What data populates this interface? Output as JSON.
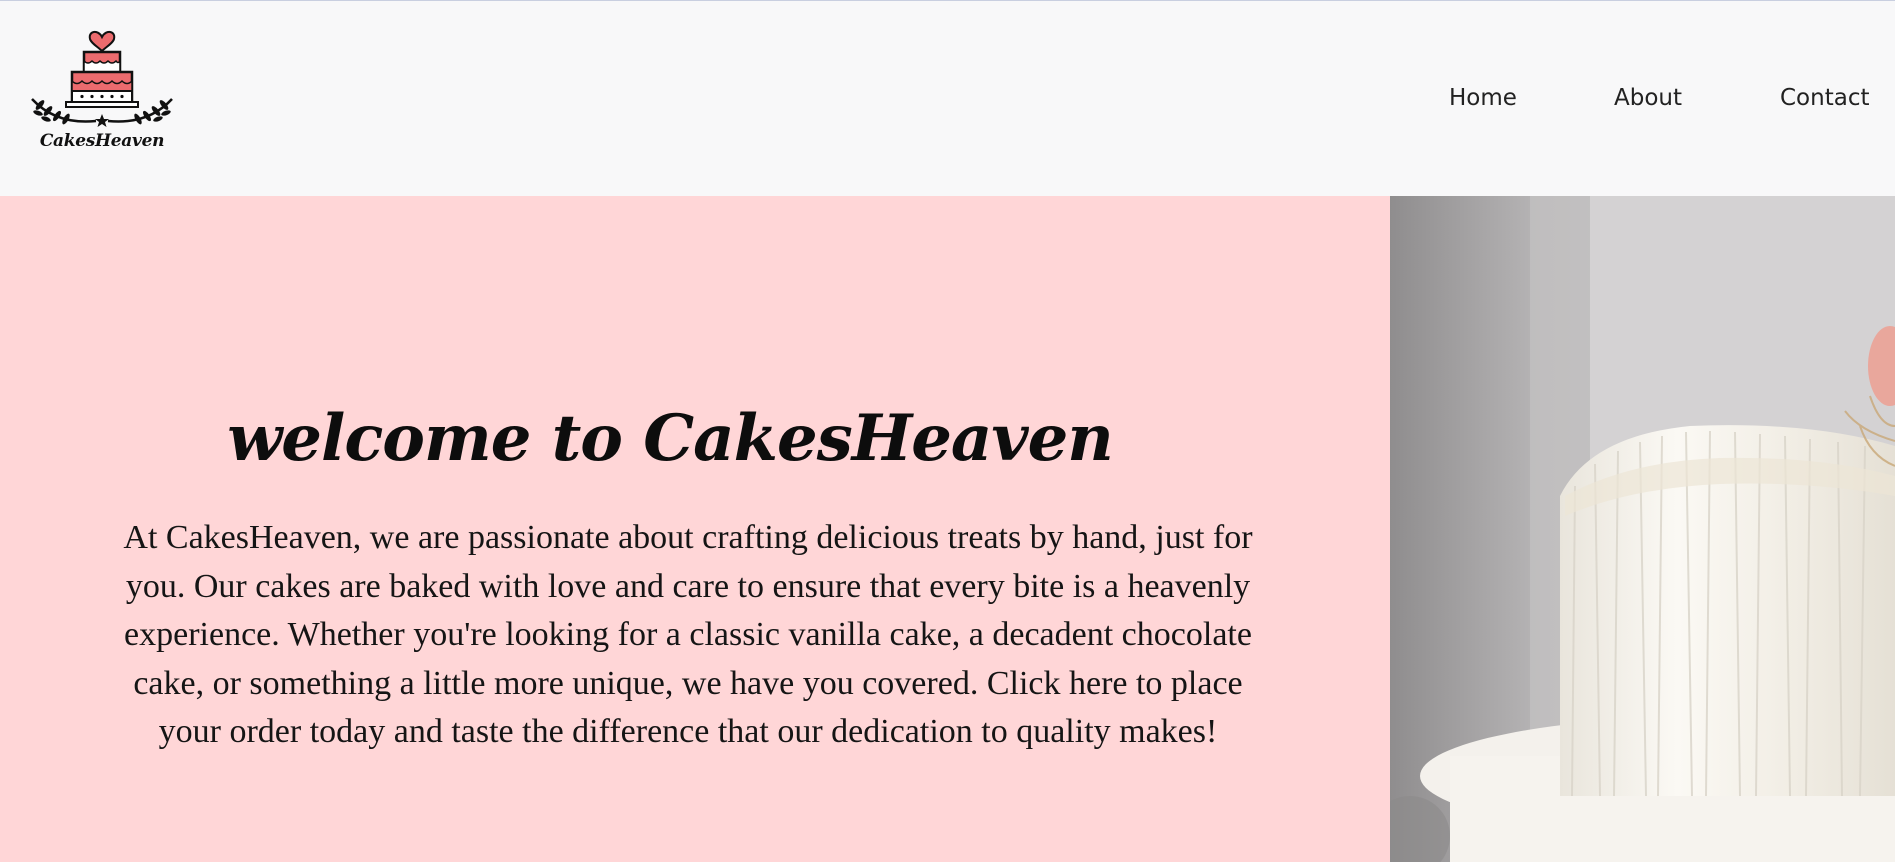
{
  "brand": {
    "name": "CakesHeaven",
    "icon": "cake-logo-icon",
    "accent": "#ec6b6e"
  },
  "nav": {
    "items": [
      "Home",
      "About",
      "Contact"
    ]
  },
  "hero": {
    "title": "welcome to CakesHeaven",
    "text": "At CakesHeaven, we are passionate about crafting delicious treats by hand, just for you. Our cakes are baked with love and care to ensure that every bite is a heavenly experience. Whether you're looking for a classic vanilla cake, a decadent chocolate cake, or something a little more unique, we have you covered. Click here to place your order today and taste the difference that our dedication to quality makes!",
    "background": "#ffd6d7"
  },
  "photo": {
    "icon": "white-cake-photo"
  }
}
